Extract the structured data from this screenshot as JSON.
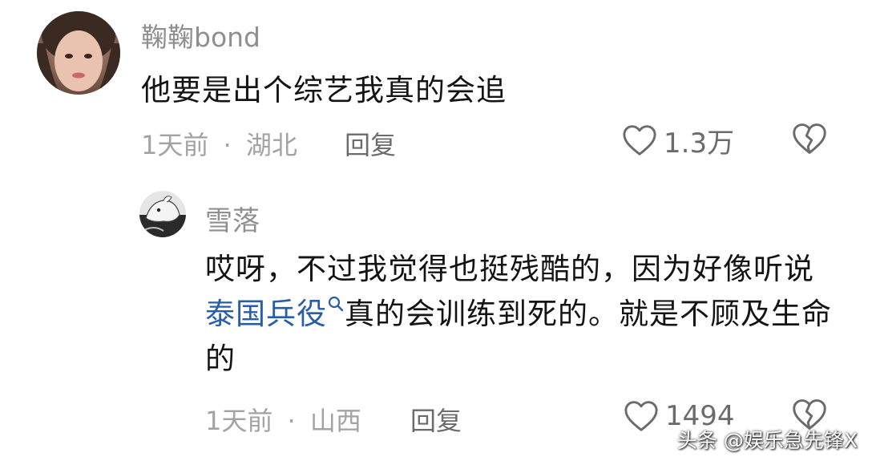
{
  "comments": [
    {
      "username": "鞠鞠bond",
      "text": "他要是出个综艺我真的会追",
      "time": "1天前",
      "separator": "·",
      "location": "湖北",
      "reply_label": "回复",
      "like_count": "1.3万"
    },
    {
      "username": "雪落",
      "text_before": "哎呀，不过我觉得也挺残酷的，因为好像听说",
      "link_text": "泰国兵役",
      "text_after": "真的会训练到死的。就是不顾及生命的",
      "time": "1天前",
      "separator": "·",
      "location": "山西",
      "reply_label": "回复",
      "like_count": "1494"
    }
  ],
  "watermark": "头条 @娱乐急先锋X",
  "icons": {
    "like": "heart-outline-icon",
    "dislike": "broken-heart-icon",
    "search": "search-icon"
  },
  "colors": {
    "link": "#2a5da8",
    "meta": "#a3a3a3",
    "username": "#8f8f8f"
  }
}
